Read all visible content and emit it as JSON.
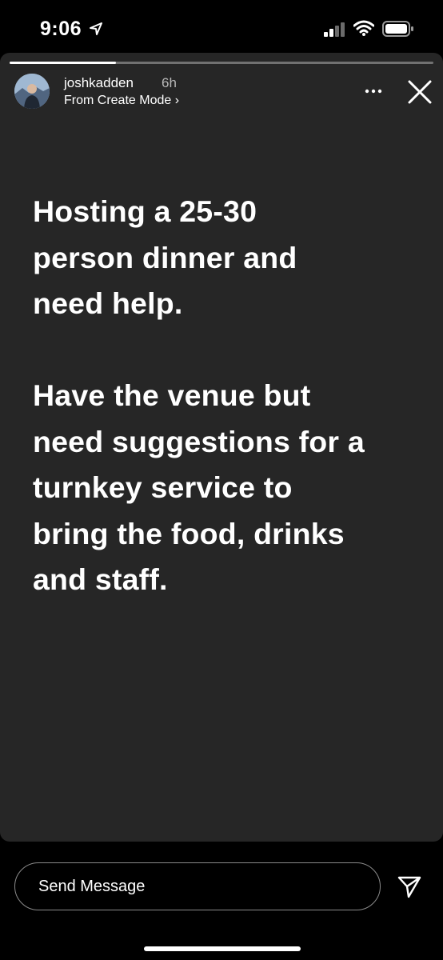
{
  "status_bar": {
    "time": "9:06",
    "location_icon": "location-arrow-icon",
    "signal_icon": "cellular-signal-icon",
    "wifi_icon": "wifi-icon",
    "battery_icon": "battery-icon"
  },
  "story": {
    "progress_fraction": 0.25,
    "username": "joshkadden",
    "time_ago": "6h",
    "subtitle": "From Create Mode ›",
    "paragraphs": [
      "Hosting a 25-30\nperson dinner and\nneed help.",
      "Have the venue but\nneed suggestions for a\nturnkey service to\nbring the food, drinks\nand staff."
    ],
    "more_icon": "more-horizontal-icon",
    "close_icon": "close-icon"
  },
  "reply": {
    "placeholder": "Send Message",
    "send_icon": "paper-plane-icon"
  },
  "colors": {
    "background": "#000000",
    "card": "#262626",
    "text": "#ffffff",
    "muted": "#b8b8b8"
  }
}
